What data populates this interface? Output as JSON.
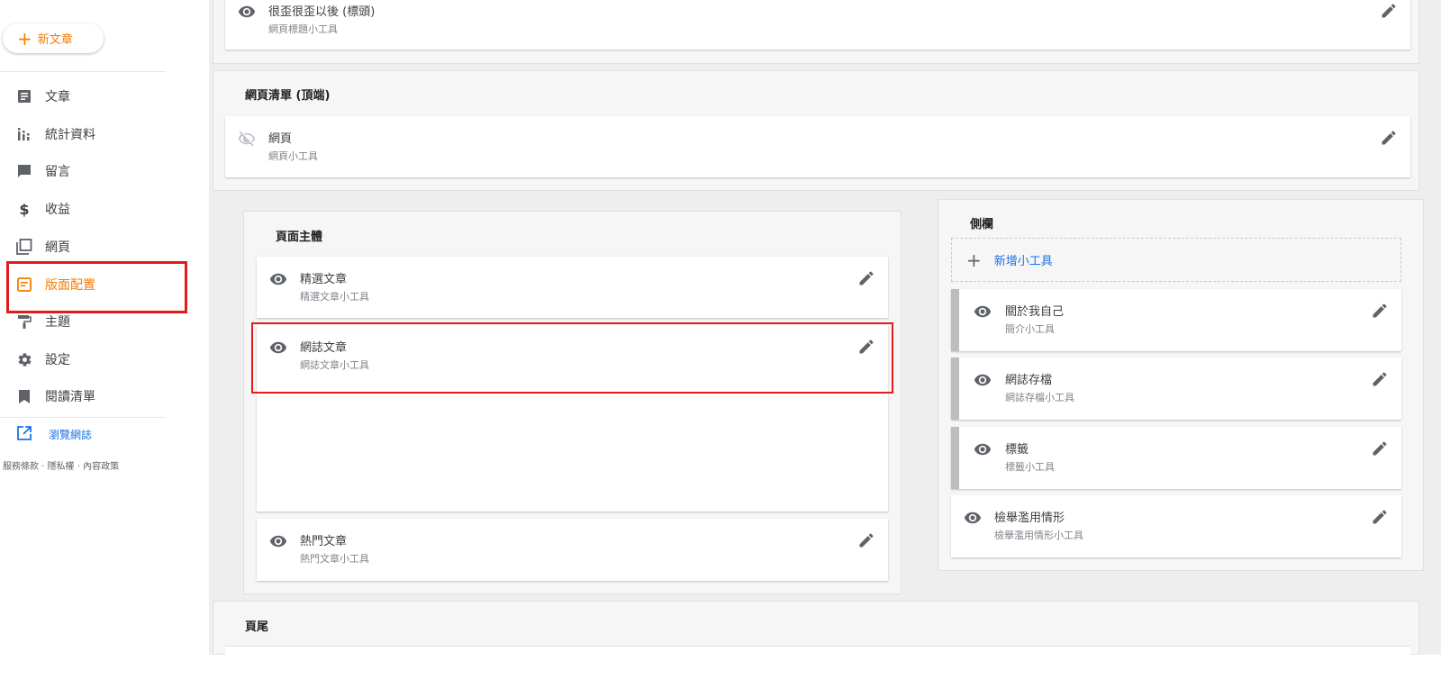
{
  "sidebar": {
    "new_post_label": "新文章",
    "items": [
      {
        "label": "文章",
        "icon": "posts-icon"
      },
      {
        "label": "統計資料",
        "icon": "stats-icon"
      },
      {
        "label": "留言",
        "icon": "comments-icon"
      },
      {
        "label": "收益",
        "icon": "earnings-icon"
      },
      {
        "label": "網頁",
        "icon": "pages-icon"
      },
      {
        "label": "版面配置",
        "icon": "layout-icon",
        "active": true
      },
      {
        "label": "主題",
        "icon": "theme-icon"
      },
      {
        "label": "設定",
        "icon": "settings-icon"
      },
      {
        "label": "閱讀清單",
        "icon": "reading-list-icon"
      }
    ],
    "view_blog_label": "瀏覽網誌",
    "footer_links": "服務條款 · 隱私權 · 內容政策"
  },
  "layout": {
    "header_widget": {
      "title": "很歪很歪以後 (標頭)",
      "subtitle": "網頁標題小工具"
    },
    "pages_top": {
      "title": "網頁清單 (頂端)",
      "widget": {
        "title": "網頁",
        "subtitle": "網頁小工具",
        "hidden": true
      }
    },
    "main_body": {
      "title": "頁面主體",
      "widgets": [
        {
          "title": "精選文章",
          "subtitle": "精選文章小工具"
        },
        {
          "title": "網誌文章",
          "subtitle": "網誌文章小工具"
        },
        {
          "title": "熱門文章",
          "subtitle": "熱門文章小工具"
        }
      ]
    },
    "sidebar_section": {
      "title": "側欄",
      "add_widget_label": "新增小工具",
      "widgets": [
        {
          "title": "關於我自己",
          "subtitle": "簡介小工具"
        },
        {
          "title": "網誌存檔",
          "subtitle": "網誌存檔小工具"
        },
        {
          "title": "標籤",
          "subtitle": "標籤小工具"
        },
        {
          "title": "檢舉濫用情形",
          "subtitle": "檢舉濫用情形小工具"
        }
      ]
    },
    "footer": {
      "title": "頁尾"
    }
  },
  "colors": {
    "accent": "#f57c00",
    "highlight": "#e21b1b",
    "link": "#1a73e8"
  }
}
